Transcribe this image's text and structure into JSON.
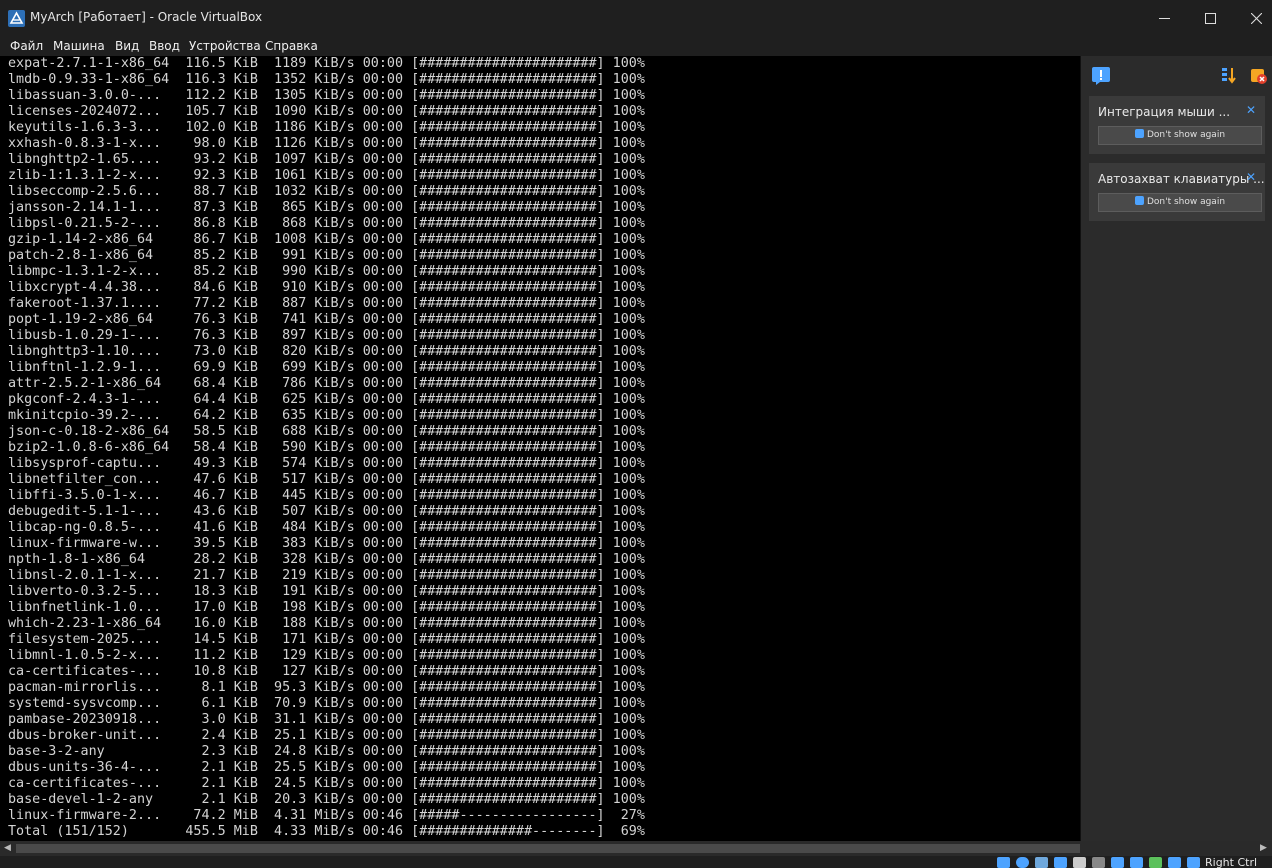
{
  "window": {
    "title": "MyArch [Работает] - Oracle VirtualBox"
  },
  "menu": [
    "Файл",
    "Машина",
    "Вид",
    "Ввод",
    "Устройства",
    "Справка"
  ],
  "terminal": {
    "lines": [
      "expat-2.7.1-1-x86_64  116.5 KiB  1189 KiB/s 00:00 [######################] 100%",
      "lmdb-0.9.33-1-x86_64  116.3 KiB  1352 KiB/s 00:00 [######################] 100%",
      "libassuan-3.0.0-...   112.2 KiB  1305 KiB/s 00:00 [######################] 100%",
      "licenses-2024072...   105.7 KiB  1090 KiB/s 00:00 [######################] 100%",
      "keyutils-1.6.3-3...   102.0 KiB  1186 KiB/s 00:00 [######################] 100%",
      "xxhash-0.8.3-1-x...    98.0 KiB  1126 KiB/s 00:00 [######################] 100%",
      "libnghttp2-1.65....    93.2 KiB  1097 KiB/s 00:00 [######################] 100%",
      "zlib-1:1.3.1-2-x...    92.3 KiB  1061 KiB/s 00:00 [######################] 100%",
      "libseccomp-2.5.6...    88.7 KiB  1032 KiB/s 00:00 [######################] 100%",
      "jansson-2.14.1-1...    87.3 KiB   865 KiB/s 00:00 [######################] 100%",
      "libpsl-0.21.5-2-...    86.8 KiB   868 KiB/s 00:00 [######################] 100%",
      "gzip-1.14-2-x86_64     86.7 KiB  1008 KiB/s 00:00 [######################] 100%",
      "patch-2.8-1-x86_64     85.2 KiB   991 KiB/s 00:00 [######################] 100%",
      "libmpc-1.3.1-2-x...    85.2 KiB   990 KiB/s 00:00 [######################] 100%",
      "libxcrypt-4.4.38...    84.6 KiB   910 KiB/s 00:00 [######################] 100%",
      "fakeroot-1.37.1....    77.2 KiB   887 KiB/s 00:00 [######################] 100%",
      "popt-1.19-2-x86_64     76.3 KiB   741 KiB/s 00:00 [######################] 100%",
      "libusb-1.0.29-1-...    76.3 KiB   897 KiB/s 00:00 [######################] 100%",
      "libnghttp3-1.10....    73.0 KiB   820 KiB/s 00:00 [######################] 100%",
      "libnftnl-1.2.9-1...    69.9 KiB   699 KiB/s 00:00 [######################] 100%",
      "attr-2.5.2-1-x86_64    68.4 KiB   786 KiB/s 00:00 [######################] 100%",
      "pkgconf-2.4.3-1-...    64.4 KiB   625 KiB/s 00:00 [######################] 100%",
      "mkinitcpio-39.2-...    64.2 KiB   635 KiB/s 00:00 [######################] 100%",
      "json-c-0.18-2-x86_64   58.5 KiB   688 KiB/s 00:00 [######################] 100%",
      "bzip2-1.0.8-6-x86_64   58.4 KiB   590 KiB/s 00:00 [######################] 100%",
      "libsysprof-captu...    49.3 KiB   574 KiB/s 00:00 [######################] 100%",
      "libnetfilter_con...    47.6 KiB   517 KiB/s 00:00 [######################] 100%",
      "libffi-3.5.0-1-x...    46.7 KiB   445 KiB/s 00:00 [######################] 100%",
      "debugedit-5.1-1-...    43.6 KiB   507 KiB/s 00:00 [######################] 100%",
      "libcap-ng-0.8.5-...    41.6 KiB   484 KiB/s 00:00 [######################] 100%",
      "linux-firmware-w...    39.5 KiB   383 KiB/s 00:00 [######################] 100%",
      "npth-1.8-1-x86_64      28.2 KiB   328 KiB/s 00:00 [######################] 100%",
      "libnsl-2.0.1-1-x...    21.7 KiB   219 KiB/s 00:00 [######################] 100%",
      "libverto-0.3.2-5...    18.3 KiB   191 KiB/s 00:00 [######################] 100%",
      "libnfnetlink-1.0...    17.0 KiB   198 KiB/s 00:00 [######################] 100%",
      "which-2.23-1-x86_64    16.0 KiB   188 KiB/s 00:00 [######################] 100%",
      "filesystem-2025....    14.5 KiB   171 KiB/s 00:00 [######################] 100%",
      "libmnl-1.0.5-2-x...    11.2 KiB   129 KiB/s 00:00 [######################] 100%",
      "ca-certificates-...    10.8 KiB   127 KiB/s 00:00 [######################] 100%",
      "pacman-mirrorlis...     8.1 KiB  95.3 KiB/s 00:00 [######################] 100%",
      "systemd-sysvcomp...     6.1 KiB  70.9 KiB/s 00:00 [######################] 100%",
      "pambase-20230918...     3.0 KiB  31.1 KiB/s 00:00 [######################] 100%",
      "dbus-broker-unit...     2.4 KiB  25.1 KiB/s 00:00 [######################] 100%",
      "base-3-2-any            2.3 KiB  24.8 KiB/s 00:00 [######################] 100%",
      "dbus-units-36-4-...     2.1 KiB  25.5 KiB/s 00:00 [######################] 100%",
      "ca-certificates-...     2.1 KiB  24.5 KiB/s 00:00 [######################] 100%",
      "base-devel-1-2-any      2.1 KiB  20.3 KiB/s 00:00 [######################] 100%",
      "linux-firmware-2...    74.2 MiB  4.31 MiB/s 00:46 [#####-----------------]  27%",
      "Total (151/152)       455.5 MiB  4.33 MiB/s 00:46 [##############--------]  69%"
    ]
  },
  "notifications": [
    {
      "title": "Интеграция мыши ...",
      "button": "Don't show again"
    },
    {
      "title": "Автозахват клавиатуры ...",
      "button": "Don't show again"
    }
  ],
  "statusbar": {
    "host_key": "Right Ctrl"
  }
}
